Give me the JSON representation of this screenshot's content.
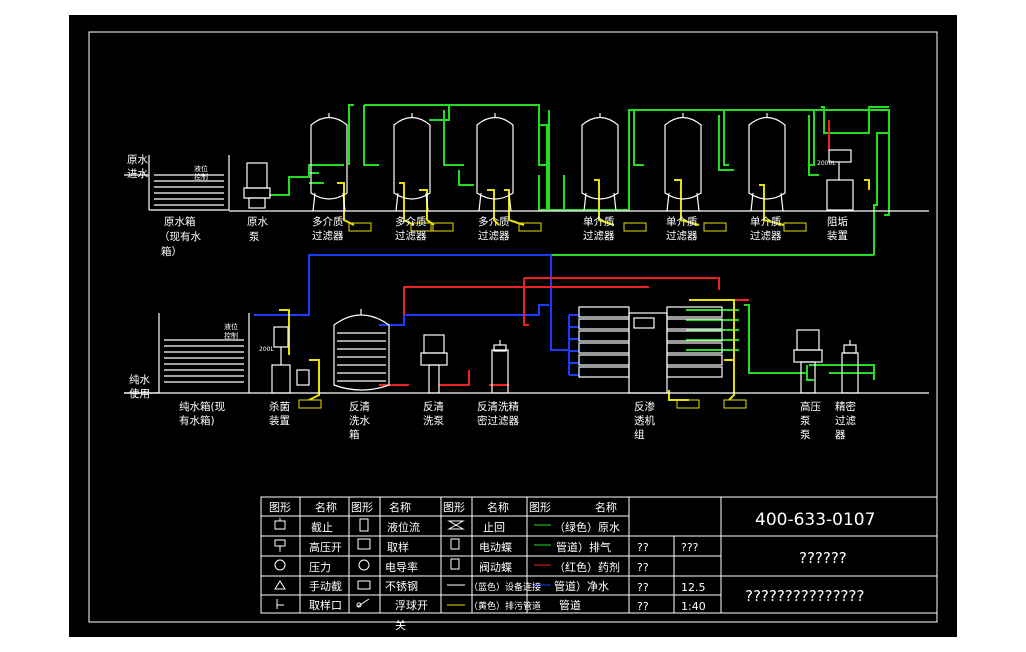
{
  "labels": {
    "raw_water_inlet_1": "原水",
    "raw_water_inlet_2": "进水",
    "level_switch_1": "液位",
    "level_switch_2": "控制",
    "raw_tank_1": "原水箱",
    "raw_tank_2": "（现有水",
    "raw_tank_3": "箱）",
    "raw_pump_1": "原水",
    "raw_pump_2": "泵",
    "multi_filter_1": "多介质",
    "multi_filter_2": "过滤器",
    "single_filter_1": "单介质",
    "single_filter_2": "过滤器",
    "scale_inhibitor_1": "阻垢",
    "scale_inhibitor_2": "装置",
    "dosing_box": "2000L",
    "pure_water_1": "纯水",
    "pure_water_2": "使用",
    "level_ctrl_1": "液位",
    "level_ctrl_2": "控制",
    "pure_tank_1": "纯水箱(现",
    "pure_tank_2": "有水箱)",
    "sterilizer_1": "杀菌",
    "sterilizer_2": "装置",
    "sterilizer_box": "200L",
    "backwash_tank_1": "反清",
    "backwash_tank_2": "洗水",
    "backwash_tank_3": "箱",
    "backwash_pump_1": "反清",
    "backwash_pump_2": "洗泵",
    "backwash_filter_1": "反清洗精",
    "backwash_filter_2": "密过滤器",
    "ro_unit_1": "反渗",
    "ro_unit_2": "透机",
    "ro_unit_3": "组",
    "hp_pump_1": "高压",
    "hp_pump_2": "泵",
    "hp_pump_3": "泵",
    "precision_filter_1": "精密",
    "precision_filter_2": "过滤",
    "precision_filter_3": "器"
  },
  "legend": {
    "headers": [
      "图形",
      "名称",
      "图形",
      "名称",
      "图形",
      "名称",
      "图形",
      "名称"
    ],
    "rows": [
      [
        "截止",
        "液位流",
        "止回",
        "（绿色）原水"
      ],
      [
        "高压开",
        "取样",
        "电动蝶",
        "管道）排气"
      ],
      [
        "压力",
        "电导率",
        "阀动蝶",
        "（红色）药剂"
      ],
      [
        "手动截",
        "不锈钢",
        "（蓝色）设备连接",
        "管道）净水"
      ],
      [
        "取样口",
        "浮球开",
        "（黄色）排污管道",
        "管道"
      ]
    ],
    "overflow": "关"
  },
  "title_block": {
    "phone": "400-633-0107",
    "drawing_name": "??????",
    "company": "???????????????",
    "cells": [
      [
        "??",
        "???"
      ],
      [
        "??",
        "??"
      ],
      [
        "??",
        "12.5"
      ],
      [
        "??",
        "1:40"
      ]
    ]
  },
  "colors": {
    "raw_pipe": "#22dd22",
    "chemical_pipe": "#ee2222",
    "pure_pipe": "#1a3cff",
    "drain_pipe": "#e8e000",
    "equipment": "#ffffff"
  }
}
